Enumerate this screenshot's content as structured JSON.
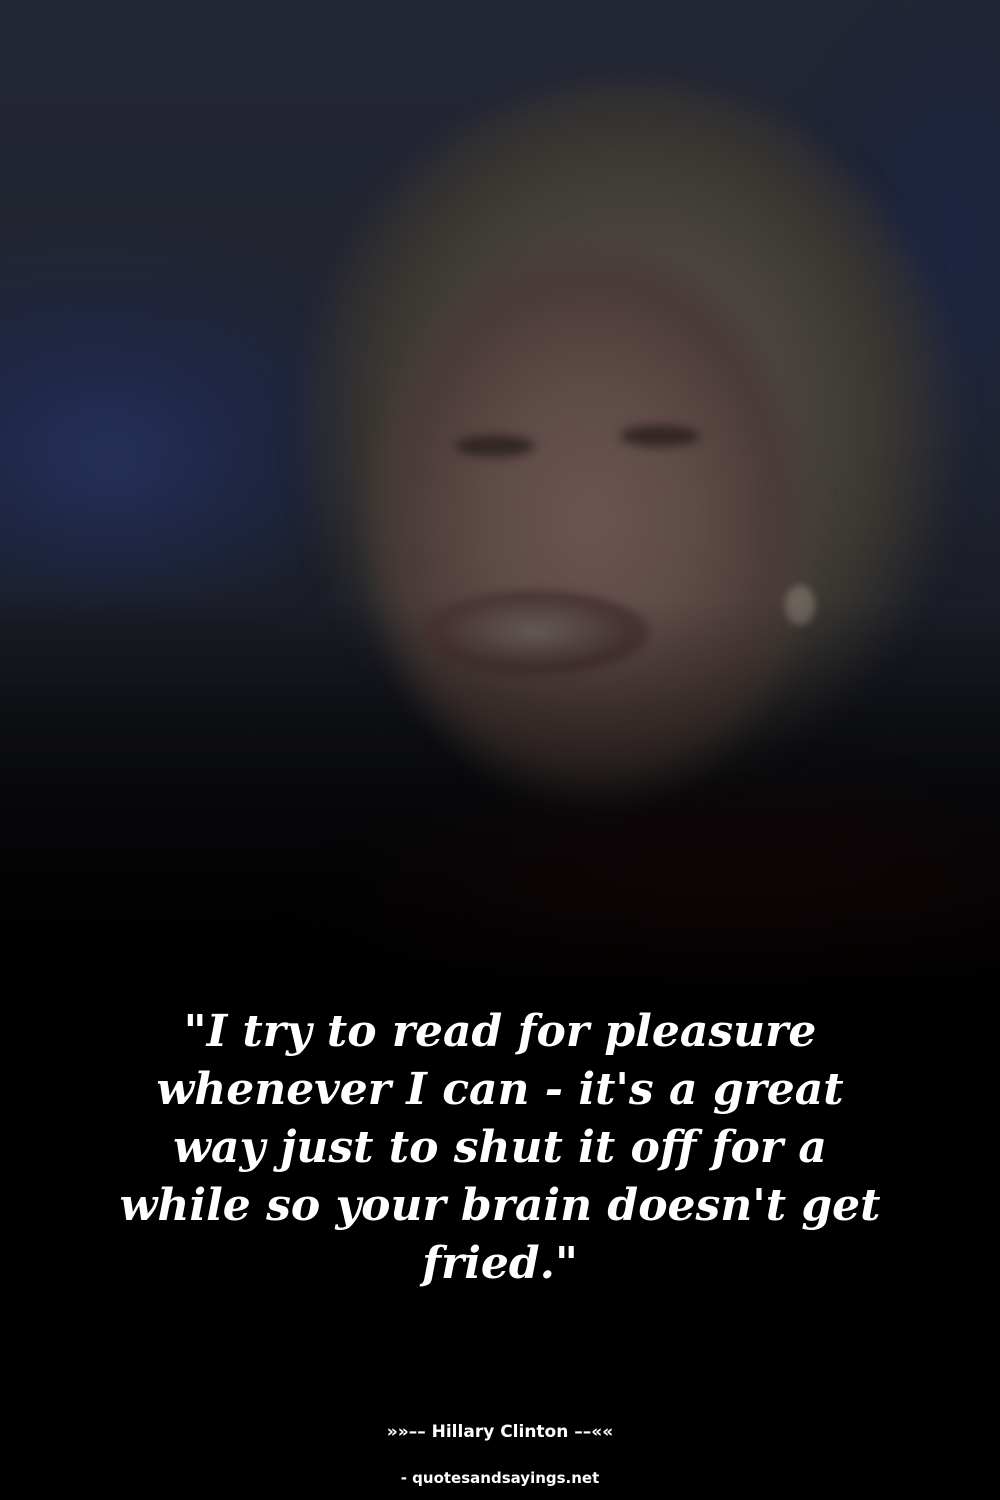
{
  "quote": {
    "text": "\"I try to read for pleasure whenever I can - it's a great way just to shut it off for a while so your brain doesn't get fried.\""
  },
  "attribution": {
    "author_line": "»»–– Hillary Clinton ––««"
  },
  "footer": {
    "source": "- quotesandsayings.net"
  },
  "colors": {
    "background": "#000000",
    "text": "#ffffff"
  }
}
